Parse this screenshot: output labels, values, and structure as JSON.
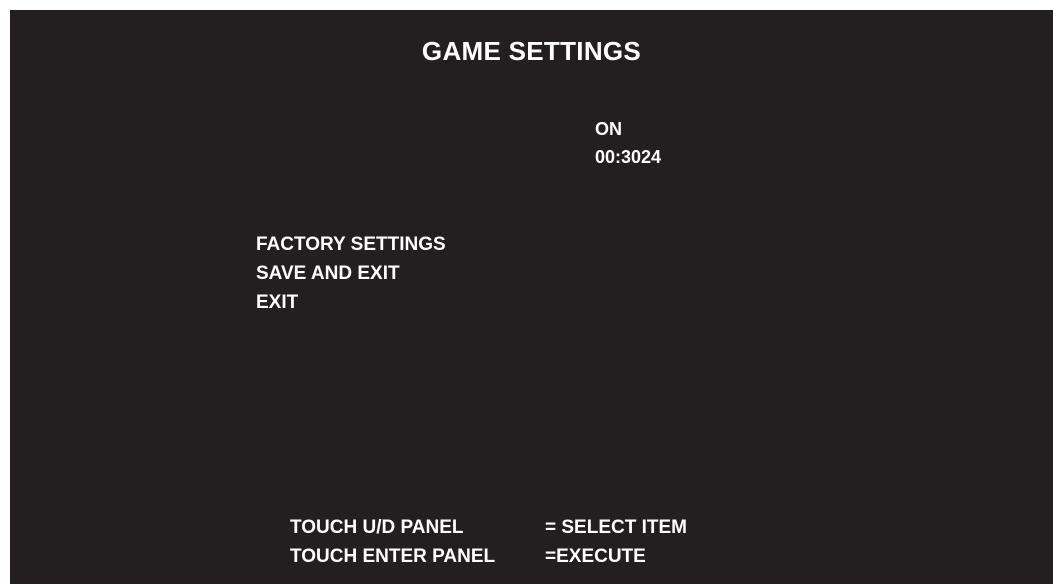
{
  "title": "GAME SETTINGS",
  "values": [
    "ON",
    "00:3024"
  ],
  "menu": {
    "factory_settings": "FACTORY SETTINGS",
    "save_and_exit": "SAVE AND EXIT",
    "exit": "EXIT"
  },
  "instructions": [
    {
      "control": "TOUCH U/D PANEL",
      "action": "= SELECT ITEM"
    },
    {
      "control": "TOUCH ENTER PANEL",
      "action": "=EXECUTE"
    }
  ],
  "colors": {
    "background": "#231f20",
    "text": "#ffffff",
    "border": "#ffffff"
  }
}
